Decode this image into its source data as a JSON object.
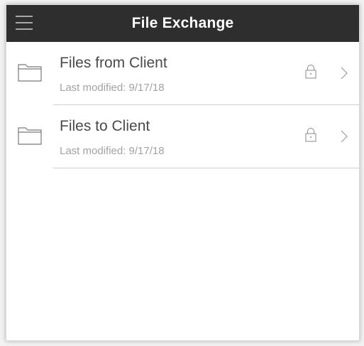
{
  "header": {
    "title": "File Exchange",
    "menu_icon": "hamburger-menu-icon",
    "background_color": "#2e2e2e"
  },
  "folders": [
    {
      "name": "Files from Client",
      "modified": "Last modified: 9/17/18",
      "icon": "folder-icon",
      "locked": true
    },
    {
      "name": "Files to Client",
      "modified": "Last modified: 9/17/18",
      "icon": "folder-icon",
      "locked": true
    }
  ]
}
